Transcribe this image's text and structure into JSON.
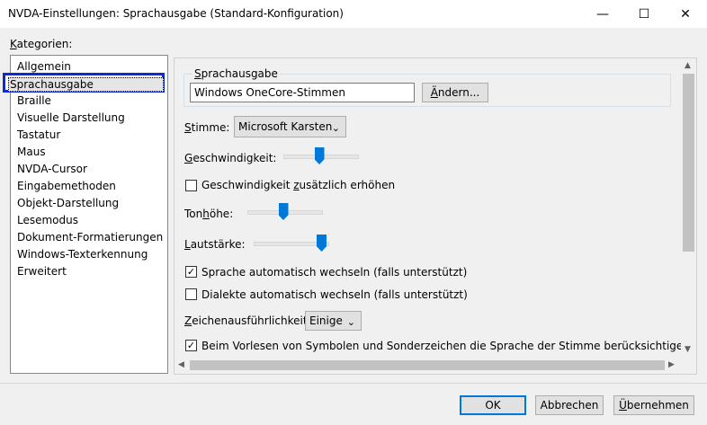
{
  "window": {
    "title": "NVDA-Einstellungen: Sprachausgabe (Standard-Konfiguration)",
    "minimize": "—",
    "maximize": "☐",
    "close": "✕"
  },
  "categories": {
    "label": "Kategorien:",
    "items": [
      "Allgemein",
      "Sprachausgabe",
      "Braille",
      "Visuelle Darstellung",
      "Tastatur",
      "Maus",
      "NVDA-Cursor",
      "Eingabemethoden",
      "Objekt-Darstellung",
      "Lesemodus",
      "Dokument-Formatierungen",
      "Windows-Texterkennung",
      "Erweitert"
    ],
    "selected_index": 1
  },
  "synth": {
    "group_label": "Sprachausgabe",
    "value": "Windows OneCore-Stimmen",
    "change_button": "Ändern..."
  },
  "voice": {
    "label": "Stimme:",
    "value": "Microsoft Karsten"
  },
  "rate": {
    "label": "Geschwindigkeit:",
    "level": 0.5
  },
  "rate_boost": {
    "label": "Geschwindigkeit zusätzlich erhöhen",
    "checked": false
  },
  "pitch": {
    "label": "Tonhöhe:",
    "level": 0.5
  },
  "volume": {
    "label": "Lautstärke:",
    "level": 1.0
  },
  "auto_language": {
    "label": "Sprache automatisch wechseln (falls unterstützt)",
    "checked": true
  },
  "auto_dialect": {
    "label": "Dialekte automatisch wechseln (falls unterstützt)",
    "checked": false
  },
  "punctuation": {
    "label": "Zeichenausführlichkeit:",
    "value": "Einige"
  },
  "symbols_language": {
    "label": "Beim Vorlesen von Symbolen und Sonderzeichen die Sprache der Stimme berücksichtigen",
    "checked": true
  },
  "footer": {
    "ok": "OK",
    "cancel": "Abbrechen",
    "apply": "Übernehmen"
  }
}
